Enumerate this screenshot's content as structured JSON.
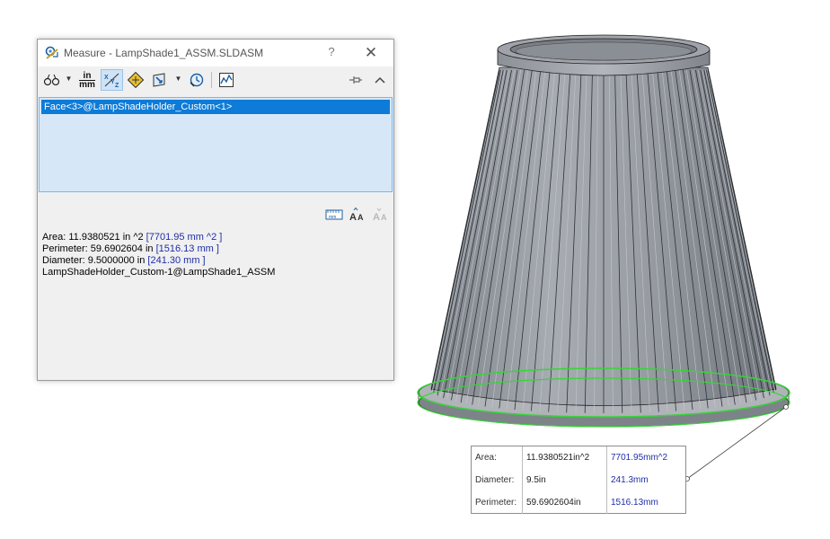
{
  "window": {
    "title": "Measure - LampShade1_ASSM.SLDASM",
    "help_label": "?",
    "close_label": "✕"
  },
  "toolbar": {
    "units_top": "in",
    "units_bottom": "mm"
  },
  "selection": {
    "items": [
      "Face<3>@LampShadeHolder_Custom<1>"
    ]
  },
  "results": {
    "area": {
      "label": "Area: 11.9380521 in ^2 ",
      "metric": "[7701.95 mm ^2 ]"
    },
    "perimeter": {
      "label": "Perimeter: 59.6902604 in ",
      "metric": "[1516.13 mm ]"
    },
    "diameter": {
      "label": "Diameter: 9.5000000 in ",
      "metric": "[241.30 mm ]"
    },
    "component": "LampShadeHolder_Custom-1@LampShade1_ASSM"
  },
  "callout": {
    "rows": [
      {
        "label": "Area:",
        "imperial": "11.9380521in^2",
        "metric": "7701.95mm^2"
      },
      {
        "label": "Diameter:",
        "imperial": "9.5in",
        "metric": "241.3mm"
      },
      {
        "label": "Perimeter:",
        "imperial": "59.6902604in",
        "metric": "1516.13mm"
      }
    ]
  },
  "colors": {
    "selection_highlight": "#0d7bd7",
    "selection_box_bg": "#d6e8f7",
    "metric_text": "#1f2ea8",
    "selected_edge": "#36d636",
    "model_body": "#8e9299"
  },
  "icons": [
    "measure-app-icon",
    "arc-condition-icon",
    "units-precision-icon",
    "show-xyz-measurements-icon",
    "point-to-point-icon",
    "projection-icon",
    "measurement-history-icon",
    "create-sensor-icon",
    "pin-icon",
    "collapse-icon",
    "show-units-icon",
    "increase-font-icon",
    "decrease-font-icon"
  ]
}
